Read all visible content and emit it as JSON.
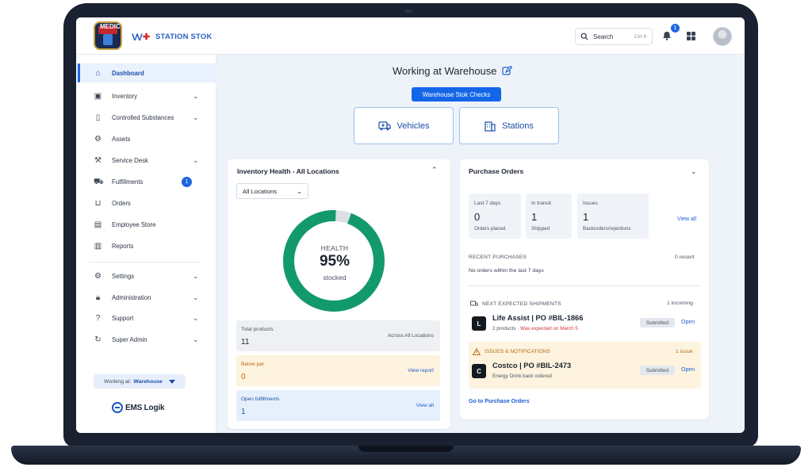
{
  "app": {
    "brand": "STATION STOK"
  },
  "search": {
    "label": "Search",
    "shortcut": "Ctrl K"
  },
  "notifications": {
    "count": "1"
  },
  "sidebar": {
    "items": [
      {
        "label": "Dashboard",
        "icon": "home-icon",
        "active": true
      },
      {
        "label": "Inventory",
        "icon": "inventory-icon",
        "chevron": true
      },
      {
        "label": "Controlled Substances",
        "icon": "clipboard-icon",
        "chevron": true
      },
      {
        "label": "Assets",
        "icon": "assets-icon"
      },
      {
        "label": "Service Desk",
        "icon": "wrench-icon",
        "chevron": true
      },
      {
        "label": "Fulfillments",
        "icon": "truck-icon",
        "badge": "1"
      },
      {
        "label": "Orders",
        "icon": "cart-icon"
      },
      {
        "label": "Employee Store",
        "icon": "store-icon"
      },
      {
        "label": "Reports",
        "icon": "reports-icon"
      },
      {
        "label": "Settings",
        "icon": "gear-icon",
        "chevron": true
      },
      {
        "label": "Administration",
        "icon": "lock-icon",
        "chevron": true
      },
      {
        "label": "Support",
        "icon": "help-icon",
        "chevron": true
      },
      {
        "label": "Super Admin",
        "icon": "refresh-icon",
        "chevron": true
      }
    ],
    "working_at_label": "Working at:",
    "working_at_value": "Warehouse",
    "footer_brand": "EMS Logik"
  },
  "main": {
    "title": "Working at Warehouse",
    "checks_button": "Warehouse Stok Checks",
    "vehicles_button": "Vehicles",
    "stations_button": "Stations"
  },
  "inventory_health": {
    "title": "Inventory Health - All Locations",
    "location_select": "All Locations",
    "health_label": "HEALTH",
    "health_pct": "95%",
    "health_value": 0.95,
    "stocked_label": "stocked",
    "total_products_label": "Total products",
    "total_products": "11",
    "total_products_note": "Across All Locations",
    "below_par_label": "Below par",
    "below_par": "0",
    "view_report": "View report",
    "open_fulfillments_label": "Open fulfillments",
    "open_fulfillments": "1",
    "view_all": "View all",
    "colors": {
      "good": "#129a6c",
      "remaining": "#dcdfe4"
    }
  },
  "purchase_orders": {
    "title": "Purchase Orders",
    "stats": [
      {
        "label": "Last 7 days",
        "value": "0",
        "sub": "Orders placed"
      },
      {
        "label": "In transit",
        "value": "1",
        "sub": "Shipped"
      },
      {
        "label": "Issues",
        "value": "1",
        "sub": "Backorders/rejections"
      }
    ],
    "view_all": "View all",
    "recent_label": "RECENT PURCHASES",
    "recent_count": "0 recent",
    "recent_empty": "No orders within the last 7 days",
    "shipments_label": "NEXT EXPECTED SHIPMENTS",
    "shipments_count": "1 incoming",
    "shipment": {
      "logo": "L",
      "title": "Life Assist | PO #BIL-1866",
      "sub": "2 products ·",
      "sub_red": "Was expected on March 5",
      "status": "Submitted",
      "action": "Open"
    },
    "issues_label": "ISSUES & NOTIFICATIONS",
    "issues_count": "1 issue",
    "issue": {
      "logo": "C",
      "title": "Costco | PO #BIL-2473",
      "sub": "Energy Drink back ordered",
      "status": "Submitted",
      "action": "Open"
    },
    "go_link": "Go to Purchase Orders"
  }
}
